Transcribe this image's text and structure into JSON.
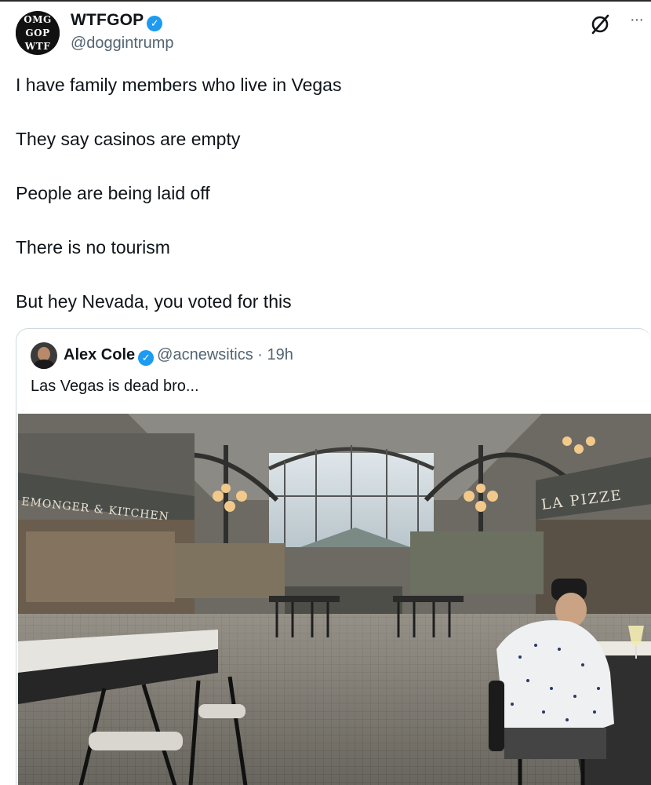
{
  "tweet": {
    "author": {
      "display_name": "WTFGOP",
      "handle": "@doggintrump",
      "avatar_lines": [
        "OMG",
        "GOP",
        "WTF"
      ],
      "verified": true
    },
    "lines": [
      "I have family members who live in Vegas",
      "They say casinos are empty",
      "People are being laid off",
      "There is no tourism",
      "But hey Nevada, you voted for this"
    ],
    "more_label": "···"
  },
  "quoted": {
    "display_name": "Alex Cole",
    "verified": true,
    "handle_time": "@acnewsitics · 19h",
    "text": "Las Vegas is dead bro...",
    "image": {
      "signs": {
        "left": "EMONGER & KITCHEN",
        "right": "LA PIZZE"
      }
    }
  },
  "colors": {
    "verified": "#1d9bf0",
    "muted": "#536471",
    "text": "#0f1419",
    "border": "#cfd9de"
  }
}
